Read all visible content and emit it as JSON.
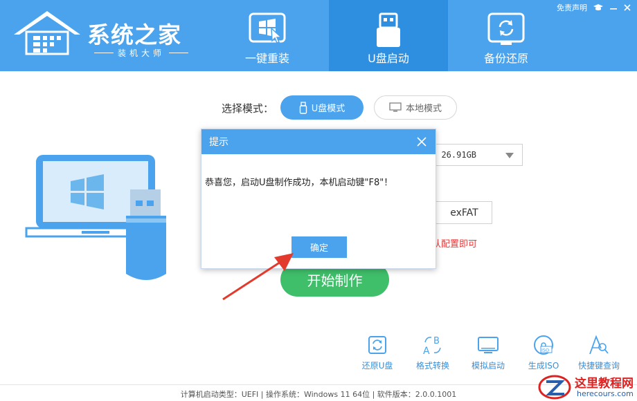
{
  "app": {
    "logo_title": "系统之家",
    "logo_subtitle": "装机大师"
  },
  "top_right": {
    "disclaimer": "免责声明"
  },
  "nav": {
    "tabs": [
      {
        "label": "一键重装",
        "icon": "windows-cursor-icon",
        "active": false
      },
      {
        "label": "U盘启动",
        "icon": "usb-drive-icon",
        "active": true
      },
      {
        "label": "备份还原",
        "icon": "backup-restore-icon",
        "active": false
      }
    ]
  },
  "mode": {
    "label": "选择模式：",
    "usb_mode": "U盘模式",
    "local_mode": "本地模式"
  },
  "device": {
    "selected_suffix": ") 26.91GB"
  },
  "filesystem": {
    "value": "exFAT"
  },
  "hint_fragment": "认配置即可",
  "start_button": "开始制作",
  "dialog": {
    "title": "提示",
    "message": "恭喜您，启动U盘制作成功，本机启动键\"F8\"！",
    "ok": "确定"
  },
  "tools": [
    {
      "label": "还原U盘",
      "icon": "restore-usb-icon"
    },
    {
      "label": "格式转换",
      "icon": "format-convert-icon"
    },
    {
      "label": "模拟启动",
      "icon": "simulate-boot-icon"
    },
    {
      "label": "生成ISO",
      "icon": "iso-disc-icon"
    },
    {
      "label": "快捷键查询",
      "icon": "shortcut-search-icon"
    }
  ],
  "status_bar": {
    "text": "计算机启动类型：UEFI | 操作系统：Windows 11 64位 | 软件版本：2.0.0.1001"
  },
  "watermark": {
    "title": "这里教程网",
    "url": "herecours.com"
  },
  "colors": {
    "primary": "#4aa3ec",
    "primary_dark": "#2e8fe0",
    "green": "#3fbf6a",
    "red_text": "#e03a3a",
    "arrow_red": "#e23b2e"
  }
}
